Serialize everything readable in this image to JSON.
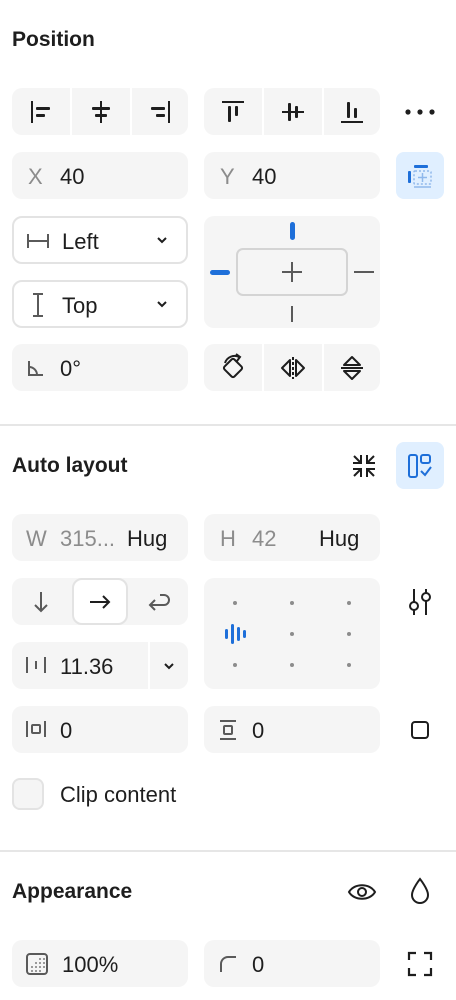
{
  "position": {
    "title": "Position",
    "x_label": "X",
    "x_value": "40",
    "y_label": "Y",
    "y_value": "40",
    "h_constraint": "Left",
    "v_constraint": "Top",
    "rotation_value": "0°"
  },
  "auto_layout": {
    "title": "Auto layout",
    "w_label": "W",
    "w_value": "315...",
    "w_mode": "Hug",
    "h_label": "H",
    "h_value": "42",
    "h_mode": "Hug",
    "gap_value": "11.36",
    "padding_h_value": "0",
    "padding_v_value": "0",
    "clip_label": "Clip content",
    "clip_checked": false
  },
  "appearance": {
    "title": "Appearance",
    "opacity_value": "100%",
    "radius_value": "0"
  },
  "colors": {
    "accent": "#1e6fd9",
    "accent_tile": "#e0efff",
    "field_bg": "#f5f5f5",
    "text": "#1e1e1e",
    "muted": "#8c8c8c"
  }
}
